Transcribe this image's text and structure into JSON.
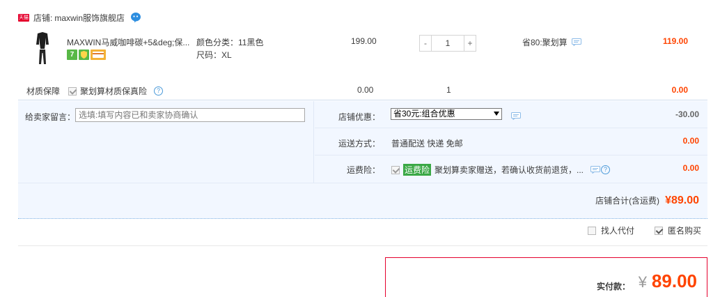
{
  "store": {
    "badge": "天猫",
    "label": "店铺:",
    "name": "maxwin服饰旗舰店"
  },
  "item": {
    "title": "MAXWIN马威咖啡碳+5&deg;保...",
    "sku_color": "颜色分类：11黑色",
    "sku_size": "尺码：XL",
    "badge_7": "7",
    "unit_price": "199.00",
    "qty_minus": "-",
    "qty_value": "1",
    "qty_plus": "+",
    "discount": "省80:聚划算",
    "subtotal": "119.00"
  },
  "insurance": {
    "label": "材质保障",
    "option": "聚划算材质保真险",
    "help": "?",
    "price": "0.00",
    "qty": "1",
    "total": "0.00"
  },
  "memo": {
    "label": "给卖家留言：",
    "placeholder": "选填:填写内容已和卖家协商确认"
  },
  "coupon": {
    "label": "店铺优惠：",
    "selected": "省30元:组合优惠",
    "value": "-30.00"
  },
  "shipping": {
    "label": "运送方式：",
    "method": "普通配送 快递 免邮",
    "value": "0.00"
  },
  "freight_insurance": {
    "label": "运费险：",
    "tag": "运费险",
    "text": "聚划算卖家赠送，若确认收货前退货，...",
    "help": "?",
    "value": "0.00"
  },
  "store_total": {
    "label": "店铺合计(含运费)",
    "value": "¥89.00"
  },
  "options": {
    "proxy_pay": "找人代付",
    "anonymous": "匿名购买"
  },
  "payment": {
    "label": "实付款：",
    "yen": "¥",
    "value": "89.00"
  },
  "colors": {
    "accent": "#ff4400",
    "brand_red": "#e5002d",
    "blue_bg": "#f2f7ff"
  }
}
